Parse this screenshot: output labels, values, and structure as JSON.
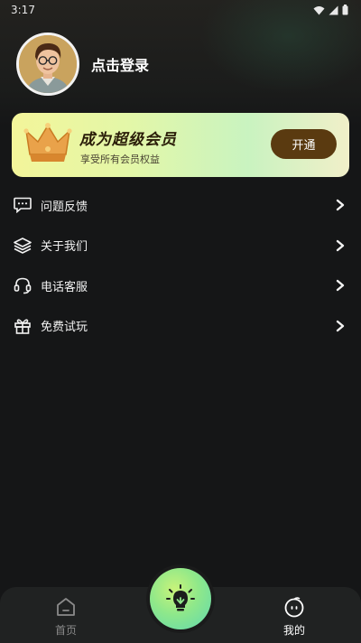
{
  "status_bar": {
    "time": "3:17"
  },
  "profile": {
    "login_text": "点击登录"
  },
  "vip": {
    "title": "成为超级会员",
    "subtitle": "享受所有会员权益",
    "button_label": "开通"
  },
  "menu": {
    "items": [
      {
        "label": "问题反馈",
        "icon": "feedback-icon"
      },
      {
        "label": "关于我们",
        "icon": "layers-icon"
      },
      {
        "label": "电话客服",
        "icon": "headset-icon"
      },
      {
        "label": "免费试玩",
        "icon": "gift-icon"
      }
    ]
  },
  "bottom_nav": {
    "home_label": "首页",
    "mine_label": "我的",
    "active": "mine"
  },
  "colors": {
    "background": "#151617",
    "vip_button": "#5a3a10",
    "accent_green": "#8fe88a",
    "nav_inactive": "#8a8a8a"
  }
}
